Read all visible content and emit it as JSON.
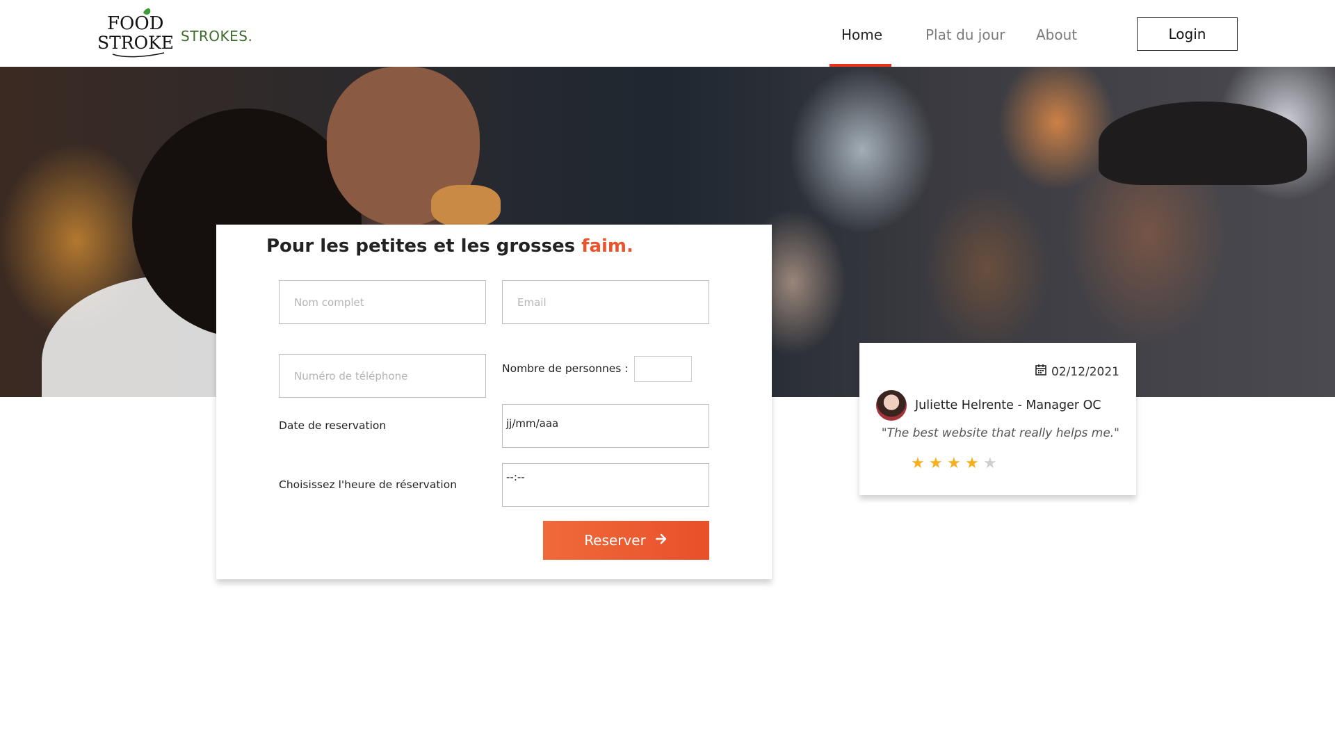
{
  "header": {
    "logo": {
      "text": "FOOD STROKES."
    },
    "brand": "STROKES.",
    "nav": [
      {
        "label": "Home",
        "active": true
      },
      {
        "label": "Plat du jour",
        "active": false
      },
      {
        "label": "About",
        "active": false
      }
    ],
    "login_label": "Login"
  },
  "form": {
    "title_main": "Pour les petites et les grosses ",
    "title_accent": "faim.",
    "accent_color": "#e8542c",
    "name_placeholder": "Nom complet",
    "email_placeholder": "Email",
    "phone_placeholder": "Numéro de téléphone",
    "count_label": "Nombre de personnes :",
    "count_value": "",
    "date_label": "Date de reservation",
    "date_value": "jj/mm/aaa",
    "time_label": "Choisissez l'heure de réservation",
    "time_value": "--:--",
    "submit_label": "Reserver"
  },
  "review": {
    "date": "02/12/2021",
    "reviewer": "Juliette Helrente - Manager OC",
    "quote": "\"The best website that really helps me.\"",
    "rating": 4,
    "max_rating": 5,
    "star_color": "#f6b01d"
  },
  "icons": {
    "calendar": "calendar-icon",
    "arrow": "arrow-right-icon",
    "star": "star-icon"
  }
}
